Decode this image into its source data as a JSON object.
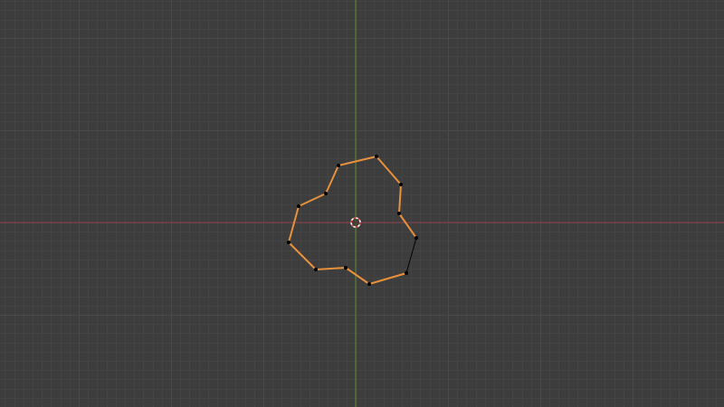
{
  "viewport": {
    "view": "top-orthographic",
    "background_color": "#3d3d3d",
    "grid": {
      "minor_color": "#444444",
      "major_color": "#4a4a4a"
    },
    "axes": {
      "x_axis_color": "#8b3a45",
      "y_axis_color": "#5a8a2a"
    },
    "origin_marker": {
      "icon": "3d-cursor-icon",
      "ring_color": "#ffffff",
      "dash_color": "#d23a3a"
    }
  },
  "mesh": {
    "edge_color": "#e8913c",
    "unselected_edge_color": "#000000",
    "vertex_color": "#000000",
    "vertex_count": 12,
    "selected_edge_count": 11
  }
}
